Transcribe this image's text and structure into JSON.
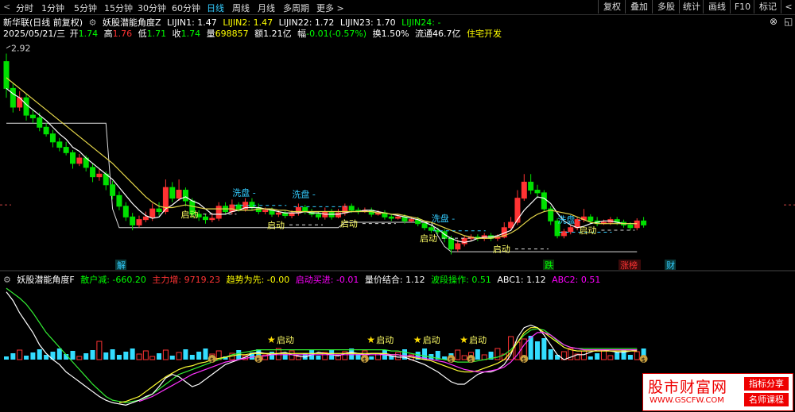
{
  "toolbar": {
    "arrow": "<",
    "periods": [
      "分时",
      "1分钟",
      "5分钟",
      "15分钟",
      "30分钟",
      "60分钟",
      "日线",
      "周线",
      "月线",
      "多周期",
      "更多 >"
    ],
    "active_period": "日线",
    "buttons": [
      "复权",
      "叠加",
      "多股",
      "统计",
      "画线",
      "F10",
      "标记",
      "<"
    ]
  },
  "header": {
    "stock": "新华联(日线 前复权)",
    "indicator": "妖股潜能角度Z",
    "lijin": [
      {
        "label": "LIJIN1: 1.47",
        "color": "#ffffff"
      },
      {
        "label": "LIJIN2: 1.47",
        "color": "#ffff00"
      },
      {
        "label": "LIJIN22: 1.72",
        "color": "#ffffff"
      },
      {
        "label": "LIJIN23: 1.70",
        "color": "#ffffff"
      },
      {
        "label": "LIJIN24: -",
        "color": "#00ff00"
      }
    ],
    "date": "2025/05/21/三",
    "open_label": "开",
    "open": "1.74",
    "high_label": "高",
    "high": "1.76",
    "low_label": "低",
    "low": "1.71",
    "close_label": "收",
    "close": "1.74",
    "vol_label": "量",
    "vol": "698857",
    "amount": "额1.21亿",
    "change_label": "幅",
    "change": "-0.01(-0.57%)",
    "turnover": "换1.50%",
    "float": "流通46.7亿",
    "industry": "住宅开发",
    "max_price": "2.92"
  },
  "sub_header": {
    "indicator": "妖股潜能角度F",
    "items": [
      {
        "label": "散户减: -660.20",
        "color": "#00ff00"
      },
      {
        "label": "主力增: 9719.23",
        "color": "#ff3333"
      },
      {
        "label": "趋势为先: -0.00",
        "color": "#ffff00"
      },
      {
        "label": "启动买进: -0.01",
        "color": "#ff00ff"
      },
      {
        "label": "量价结合: 1.12",
        "color": "#ffffff"
      },
      {
        "label": "波段操作: 0.51",
        "color": "#00ff00"
      },
      {
        "label": "ABC1: 1.12",
        "color": "#ffffff"
      },
      {
        "label": "ABC2: 0.51",
        "color": "#ff00ff"
      }
    ]
  },
  "annotations": {
    "xipan": "洗盘",
    "qidong": "启动",
    "jie": "解",
    "die": "跌",
    "zhangbang": "涨榜",
    "cai": "财",
    "money": "$"
  },
  "chart_data": {
    "type": "candlestick",
    "candles": [
      [
        2.82,
        2.62,
        2.88,
        2.55
      ],
      [
        2.62,
        2.48,
        2.66,
        2.44
      ],
      [
        2.48,
        2.55,
        2.6,
        2.45
      ],
      [
        2.55,
        2.42,
        2.58,
        2.38
      ],
      [
        2.42,
        2.4,
        2.46,
        2.36
      ],
      [
        2.4,
        2.33,
        2.44,
        2.3
      ],
      [
        2.33,
        2.28,
        2.36,
        2.26
      ],
      [
        2.28,
        2.22,
        2.31,
        2.18
      ],
      [
        2.22,
        2.18,
        2.25,
        2.15
      ],
      [
        2.18,
        2.14,
        2.22,
        2.12
      ],
      [
        2.14,
        2.06,
        2.16,
        2.02
      ],
      [
        2.06,
        2.1,
        2.13,
        2.04
      ],
      [
        2.1,
        2.03,
        2.12,
        2.0
      ],
      [
        2.03,
        1.96,
        2.06,
        1.92
      ],
      [
        1.96,
        1.98,
        2.02,
        1.93
      ],
      [
        1.98,
        1.9,
        2.0,
        1.86
      ],
      [
        1.9,
        1.82,
        1.93,
        1.79
      ],
      [
        1.82,
        1.74,
        1.85,
        1.71
      ],
      [
        1.74,
        1.66,
        1.77,
        1.63
      ],
      [
        1.66,
        1.6,
        1.69,
        1.56
      ],
      [
        1.6,
        1.64,
        1.67,
        1.58
      ],
      [
        1.64,
        1.66,
        1.7,
        1.62
      ],
      [
        1.66,
        1.72,
        1.76,
        1.63
      ],
      [
        1.72,
        1.7,
        1.77,
        1.67
      ],
      [
        1.7,
        1.88,
        1.94,
        1.68
      ],
      [
        1.88,
        1.8,
        1.92,
        1.77
      ],
      [
        1.8,
        1.86,
        1.94,
        1.78
      ],
      [
        1.86,
        1.78,
        1.88,
        1.74
      ],
      [
        1.78,
        1.68,
        1.8,
        1.65
      ],
      [
        1.68,
        1.66,
        1.71,
        1.63
      ],
      [
        1.66,
        1.64,
        1.68,
        1.61
      ],
      [
        1.64,
        1.65,
        1.69,
        1.62
      ],
      [
        1.65,
        1.74,
        1.77,
        1.63
      ],
      [
        1.74,
        1.7,
        1.77,
        1.68
      ],
      [
        1.7,
        1.75,
        1.79,
        1.68
      ],
      [
        1.75,
        1.72,
        1.77,
        1.7
      ],
      [
        1.72,
        1.77,
        1.8,
        1.7
      ],
      [
        1.77,
        1.73,
        1.8,
        1.71
      ],
      [
        1.73,
        1.7,
        1.76,
        1.68
      ],
      [
        1.7,
        1.71,
        1.73,
        1.68
      ],
      [
        1.71,
        1.68,
        1.73,
        1.66
      ],
      [
        1.68,
        1.69,
        1.71,
        1.66
      ],
      [
        1.69,
        1.67,
        1.71,
        1.65
      ],
      [
        1.67,
        1.69,
        1.71,
        1.65
      ],
      [
        1.69,
        1.73,
        1.76,
        1.67
      ],
      [
        1.73,
        1.7,
        1.75,
        1.68
      ],
      [
        1.7,
        1.68,
        1.72,
        1.66
      ],
      [
        1.68,
        1.66,
        1.7,
        1.64
      ],
      [
        1.66,
        1.7,
        1.73,
        1.64
      ],
      [
        1.7,
        1.66,
        1.72,
        1.64
      ],
      [
        1.66,
        1.69,
        1.72,
        1.65
      ],
      [
        1.69,
        1.74,
        1.76,
        1.67
      ],
      [
        1.74,
        1.71,
        1.76,
        1.69
      ],
      [
        1.71,
        1.7,
        1.73,
        1.68
      ],
      [
        1.7,
        1.71,
        1.73,
        1.69
      ],
      [
        1.71,
        1.68,
        1.73,
        1.66
      ],
      [
        1.68,
        1.69,
        1.71,
        1.67
      ],
      [
        1.69,
        1.66,
        1.71,
        1.64
      ],
      [
        1.66,
        1.65,
        1.68,
        1.63
      ],
      [
        1.65,
        1.66,
        1.68,
        1.64
      ],
      [
        1.66,
        1.63,
        1.68,
        1.61
      ],
      [
        1.63,
        1.64,
        1.66,
        1.62
      ],
      [
        1.64,
        1.61,
        1.66,
        1.59
      ],
      [
        1.61,
        1.58,
        1.63,
        1.56
      ],
      [
        1.58,
        1.56,
        1.6,
        1.54
      ],
      [
        1.56,
        1.55,
        1.58,
        1.53
      ],
      [
        1.55,
        1.5,
        1.57,
        1.47
      ],
      [
        1.5,
        1.42,
        1.52,
        1.38
      ],
      [
        1.42,
        1.46,
        1.49,
        1.4
      ],
      [
        1.46,
        1.5,
        1.52,
        1.44
      ],
      [
        1.5,
        1.51,
        1.53,
        1.48
      ],
      [
        1.51,
        1.5,
        1.53,
        1.48
      ],
      [
        1.5,
        1.52,
        1.54,
        1.48
      ],
      [
        1.52,
        1.5,
        1.54,
        1.48
      ],
      [
        1.5,
        1.51,
        1.53,
        1.48
      ],
      [
        1.51,
        1.58,
        1.62,
        1.5
      ],
      [
        1.58,
        1.62,
        1.66,
        1.56
      ],
      [
        1.62,
        1.8,
        1.86,
        1.6
      ],
      [
        1.8,
        1.92,
        1.98,
        1.78
      ],
      [
        1.92,
        1.86,
        1.98,
        1.83
      ],
      [
        1.86,
        1.84,
        1.9,
        1.8
      ],
      [
        1.84,
        1.72,
        1.86,
        1.7
      ],
      [
        1.72,
        1.63,
        1.74,
        1.6
      ],
      [
        1.63,
        1.52,
        1.65,
        1.5
      ],
      [
        1.52,
        1.55,
        1.57,
        1.5
      ],
      [
        1.55,
        1.58,
        1.6,
        1.53
      ],
      [
        1.58,
        1.64,
        1.66,
        1.56
      ],
      [
        1.64,
        1.66,
        1.72,
        1.62
      ],
      [
        1.66,
        1.63,
        1.68,
        1.61
      ],
      [
        1.63,
        1.61,
        1.66,
        1.59
      ],
      [
        1.61,
        1.62,
        1.64,
        1.6
      ],
      [
        1.62,
        1.64,
        1.66,
        1.6
      ],
      [
        1.64,
        1.62,
        1.66,
        1.6
      ],
      [
        1.62,
        1.6,
        1.64,
        1.58
      ],
      [
        1.6,
        1.58,
        1.62,
        1.56
      ],
      [
        1.58,
        1.63,
        1.65,
        1.56
      ],
      [
        1.63,
        1.6,
        1.66,
        1.58
      ]
    ],
    "ma5": [
      2.62,
      2.58,
      2.55,
      2.5,
      2.46,
      2.42,
      2.38,
      2.33,
      2.28,
      2.24,
      2.18,
      2.15,
      2.1,
      2.06,
      2.02,
      1.98,
      1.94,
      1.88,
      1.82,
      1.76,
      1.71,
      1.67,
      1.65,
      1.66,
      1.72,
      1.75,
      1.79,
      1.81,
      1.78,
      1.76,
      1.72,
      1.68,
      1.68,
      1.68,
      1.7,
      1.71,
      1.73,
      1.73,
      1.73,
      1.72,
      1.71,
      1.7,
      1.69,
      1.69,
      1.69,
      1.7,
      1.69,
      1.69,
      1.68,
      1.68,
      1.68,
      1.69,
      1.7,
      1.7,
      1.71,
      1.71,
      1.7,
      1.69,
      1.68,
      1.67,
      1.66,
      1.65,
      1.64,
      1.62,
      1.6,
      1.57,
      1.53,
      1.5,
      1.48,
      1.47,
      1.48,
      1.5,
      1.51,
      1.51,
      1.52,
      1.54,
      1.56,
      1.64,
      1.71,
      1.76,
      1.81,
      1.8,
      1.76,
      1.69,
      1.63,
      1.6,
      1.58,
      1.59,
      1.61,
      1.62,
      1.63,
      1.63,
      1.62,
      1.61,
      1.61,
      1.61
    ],
    "ma10": [
      2.7,
      2.66,
      2.62,
      2.58,
      2.54,
      2.5,
      2.46,
      2.42,
      2.38,
      2.34,
      2.3,
      2.26,
      2.22,
      2.18,
      2.14,
      2.1,
      2.06,
      2.01,
      1.96,
      1.91,
      1.86,
      1.81,
      1.77,
      1.74,
      1.73,
      1.73,
      1.74,
      1.75,
      1.74,
      1.73,
      1.72,
      1.72,
      1.72,
      1.72,
      1.72,
      1.71,
      1.71,
      1.71,
      1.72,
      1.72,
      1.72,
      1.71,
      1.71,
      1.7,
      1.7,
      1.7,
      1.7,
      1.7,
      1.7,
      1.7,
      1.7,
      1.7,
      1.7,
      1.7,
      1.7,
      1.7,
      1.69,
      1.69,
      1.68,
      1.68,
      1.67,
      1.66,
      1.65,
      1.63,
      1.62,
      1.6,
      1.58,
      1.56,
      1.54,
      1.52,
      1.51,
      1.5,
      1.5,
      1.5,
      1.51,
      1.52,
      1.54,
      1.57,
      1.61,
      1.65,
      1.68,
      1.7,
      1.71,
      1.7,
      1.69,
      1.68,
      1.66,
      1.64,
      1.62,
      1.61,
      1.61,
      1.61,
      1.61,
      1.61,
      1.61,
      1.61
    ],
    "support_line": [
      2.36,
      2.36,
      2.36,
      2.36,
      2.36,
      2.36,
      2.36,
      2.36,
      2.36,
      2.36,
      2.36,
      2.36,
      2.36,
      2.36,
      2.36,
      2.36,
      1.72,
      1.58,
      1.58,
      1.58,
      1.58,
      1.58,
      1.58,
      1.58,
      1.58,
      1.58,
      1.58,
      1.58,
      1.58,
      1.58,
      1.58,
      1.58,
      1.58,
      1.58,
      1.58,
      1.58,
      1.58,
      1.58,
      1.58,
      1.58,
      1.58,
      1.58,
      1.58,
      1.58,
      1.58,
      1.58,
      1.58,
      1.58,
      1.58,
      1.58,
      1.58,
      1.62,
      1.62,
      1.62,
      1.62,
      1.62,
      1.62,
      1.62,
      1.62,
      1.62,
      1.62,
      1.62,
      1.62,
      1.62,
      1.62,
      1.52,
      1.44,
      1.4,
      1.4,
      1.4,
      1.4,
      1.4,
      1.4,
      1.4,
      1.4,
      1.4,
      1.4,
      1.4,
      1.4,
      1.4,
      1.4,
      1.4,
      1.4,
      1.4,
      1.4,
      1.4,
      1.4,
      1.4,
      1.4,
      1.4,
      1.4,
      1.4,
      1.4,
      1.4,
      1.4,
      1.4
    ],
    "dashed_level": 1.75,
    "y_range": [
      1.3,
      2.96
    ],
    "sub": {
      "white": [
        0.95,
        0.88,
        0.78,
        0.7,
        0.62,
        0.52,
        0.45,
        0.4,
        0.36,
        0.3,
        0.26,
        0.22,
        0.18,
        0.14,
        0.1,
        0.07,
        0.05,
        0.04,
        0.03,
        0.05,
        0.07,
        0.1,
        0.12,
        0.18,
        0.25,
        0.28,
        0.26,
        0.22,
        0.18,
        0.2,
        0.24,
        0.28,
        0.32,
        0.36,
        0.38,
        0.4,
        0.42,
        0.45,
        0.46,
        0.45,
        0.44,
        0.45,
        0.46,
        0.44,
        0.43,
        0.42,
        0.44,
        0.46,
        0.45,
        0.44,
        0.43,
        0.45,
        0.46,
        0.45,
        0.44,
        0.45,
        0.45,
        0.44,
        0.43,
        0.42,
        0.42,
        0.4,
        0.38,
        0.36,
        0.33,
        0.3,
        0.26,
        0.22,
        0.2,
        0.2,
        0.24,
        0.28,
        0.3,
        0.3,
        0.32,
        0.36,
        0.44,
        0.58,
        0.66,
        0.68,
        0.66,
        0.6,
        0.52,
        0.44,
        0.4,
        0.42,
        0.44,
        0.44,
        0.46,
        0.48,
        0.48,
        0.47,
        0.46,
        0.46,
        0.47,
        0.48
      ],
      "green": [
        0.98,
        0.94,
        0.9,
        0.85,
        0.78,
        0.7,
        0.62,
        0.56,
        0.5,
        0.44,
        0.38,
        0.32,
        0.26,
        0.2,
        0.15,
        0.1,
        0.07,
        0.06,
        0.05,
        0.06,
        0.07,
        0.09,
        0.12,
        0.16,
        0.2,
        0.24,
        0.28,
        0.3,
        0.32,
        0.34,
        0.36,
        0.38,
        0.4,
        0.42,
        0.44,
        0.45,
        0.46,
        0.47,
        0.48,
        0.48,
        0.48,
        0.48,
        0.48,
        0.48,
        0.48,
        0.48,
        0.48,
        0.48,
        0.48,
        0.48,
        0.48,
        0.48,
        0.48,
        0.48,
        0.48,
        0.48,
        0.48,
        0.48,
        0.47,
        0.47,
        0.46,
        0.45,
        0.44,
        0.43,
        0.42,
        0.41,
        0.4,
        0.39,
        0.38,
        0.38,
        0.38,
        0.39,
        0.4,
        0.41,
        0.42,
        0.44,
        0.48,
        0.54,
        0.6,
        0.64,
        0.65,
        0.64,
        0.6,
        0.55,
        0.52,
        0.5,
        0.49,
        0.49,
        0.49,
        0.49,
        0.49,
        0.49,
        0.49,
        0.49,
        0.49,
        0.49
      ],
      "yellow": [
        null,
        null,
        null,
        null,
        null,
        null,
        null,
        null,
        null,
        null,
        null,
        null,
        null,
        null,
        null,
        null,
        null,
        0.05,
        0.06,
        0.08,
        0.1,
        0.14,
        0.18,
        0.22,
        0.26,
        0.29,
        0.32,
        0.34,
        0.35,
        0.37,
        0.38,
        0.4,
        0.41,
        0.42,
        0.43,
        0.44,
        0.44,
        0.45,
        0.45,
        0.45,
        0.45,
        0.45,
        0.45,
        0.45,
        0.45,
        0.45,
        0.45,
        0.45,
        0.45,
        0.45,
        0.45,
        0.45,
        0.45,
        0.45,
        0.45,
        0.45,
        0.45,
        0.45,
        0.44,
        0.44,
        0.43,
        0.42,
        0.41,
        0.4,
        0.39,
        0.37,
        0.35,
        0.33,
        0.31,
        0.3,
        0.3,
        0.31,
        0.33,
        0.35,
        0.37,
        0.4,
        0.46,
        0.54,
        0.62,
        0.66,
        0.66,
        0.62,
        0.58,
        0.54,
        0.5,
        0.48,
        0.47,
        0.47,
        0.47,
        0.47,
        0.47,
        0.47,
        0.47,
        0.47,
        0.47,
        0.47
      ],
      "magenta": [
        null,
        null,
        null,
        null,
        null,
        null,
        null,
        null,
        null,
        null,
        null,
        null,
        null,
        null,
        null,
        null,
        null,
        null,
        null,
        null,
        0.06,
        0.08,
        0.1,
        0.13,
        0.16,
        0.19,
        0.22,
        0.25,
        0.28,
        0.3,
        0.32,
        0.34,
        0.36,
        0.38,
        0.39,
        0.4,
        0.41,
        0.42,
        0.43,
        0.43,
        0.44,
        0.44,
        0.44,
        0.44,
        0.44,
        0.44,
        0.44,
        0.44,
        0.44,
        0.44,
        0.44,
        0.44,
        0.44,
        0.44,
        0.44,
        0.44,
        0.44,
        0.44,
        0.44,
        0.44,
        0.43,
        0.43,
        0.42,
        0.41,
        0.4,
        0.39,
        0.38,
        0.36,
        0.34,
        0.32,
        0.31,
        0.3,
        0.3,
        0.31,
        0.32,
        0.34,
        0.38,
        0.44,
        0.52,
        0.58,
        0.62,
        0.62,
        0.6,
        0.56,
        0.52,
        0.5,
        0.49,
        0.48,
        0.48,
        0.48,
        0.48,
        0.48,
        0.48,
        0.48,
        0.48,
        0.48
      ]
    },
    "xipan_at": [
      35,
      44,
      65,
      84,
      111,
      118
    ],
    "qidong_at": [
      27,
      40,
      51,
      63,
      74,
      87,
      104,
      118
    ],
    "sub_qidong_at": [
      40,
      55,
      62,
      69,
      118
    ],
    "money_at": [
      31,
      38,
      54,
      67,
      70,
      78,
      96,
      112,
      114,
      116,
      120,
      122
    ]
  }
}
